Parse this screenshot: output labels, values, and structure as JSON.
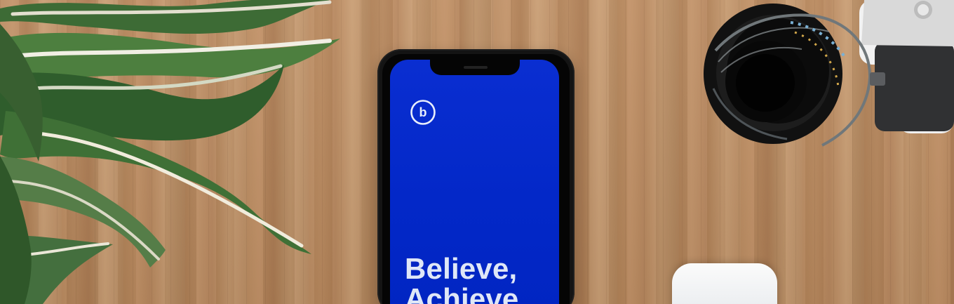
{
  "screen": {
    "logo_letter": "b",
    "tagline_line_1": "Believe,",
    "tagline_line_2": "Achieve"
  },
  "objects": {
    "plant_icon": "plant-leaves-icon",
    "camera_icon": "camera-lens-icon",
    "earbuds_icon": "earbuds-case-icon"
  },
  "colors": {
    "table_wood": "#b9895e",
    "phone_screen": "#0328c8",
    "phone_body": "#141414",
    "text_light": "#dfe7f7"
  }
}
